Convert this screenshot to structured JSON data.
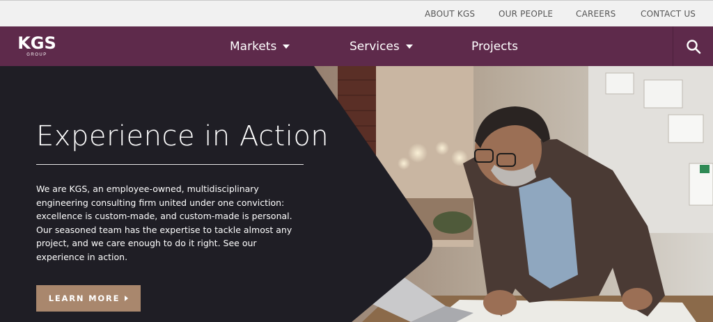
{
  "utility_nav": {
    "about": "ABOUT KGS",
    "people": "OUR PEOPLE",
    "careers": "CAREERS",
    "contact": "CONTACT US"
  },
  "logo": {
    "mark": "KGS",
    "sub": "GROUP"
  },
  "main_nav": {
    "markets": "Markets",
    "services": "Services",
    "projects": "Projects",
    "search_icon": "search-icon"
  },
  "hero": {
    "title": "Experience in Action",
    "body": "We are KGS, an employee-owned, multidisciplinary engineering consulting firm united under one conviction: excellence is custom-made, and custom-made is personal. Our seasoned team has the expertise to tackle almost any project, and we care enough to do it right. See our experience in action.",
    "button": "LEARN MORE"
  },
  "colors": {
    "brand_purple": "#5e2a4b",
    "hero_dark": "#1f1e25",
    "button_tan": "#a9876d",
    "utility_bg": "#f1f1f1"
  }
}
